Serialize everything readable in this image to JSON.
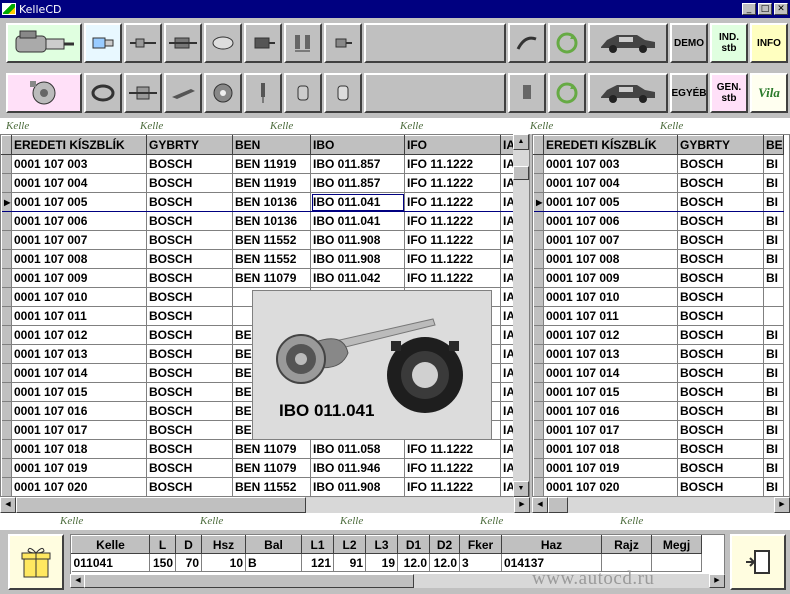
{
  "window": {
    "title": "KelleCD",
    "minimize_glyph": "_",
    "maximize_glyph": "□",
    "close_glyph": "✕"
  },
  "toolbar1": {
    "demo_label": "DEMO",
    "ind_label_1": "IND.",
    "ind_label_2": "stb",
    "info_label": "INFO"
  },
  "toolbar2": {
    "egyeb_label": "EGYÉB",
    "gen_label_1": "GEN.",
    "gen_label_2": "stb",
    "logo_text": "Vila"
  },
  "ornament_text": "Kelle",
  "grid_left": {
    "columns": [
      "EREDETI KÍSZBLÍK",
      "GYBRTY",
      "BEN",
      "IBO",
      "IFO",
      "IA"
    ],
    "rows": [
      [
        "0001 107 003",
        "BOSCH",
        "BEN 11919",
        "IBO 011.857",
        "IFO 11.1222",
        "IA"
      ],
      [
        "0001 107 004",
        "BOSCH",
        "BEN 11919",
        "IBO 011.857",
        "IFO 11.1222",
        "IA"
      ],
      [
        "0001 107 005",
        "BOSCH",
        "BEN 10136",
        "IBO 011.041",
        "IFO 11.1222",
        "IA"
      ],
      [
        "0001 107 006",
        "BOSCH",
        "BEN 10136",
        "IBO 011.041",
        "IFO 11.1222",
        "IA"
      ],
      [
        "0001 107 007",
        "BOSCH",
        "BEN 11552",
        "IBO 011.908",
        "IFO 11.1222",
        "IA"
      ],
      [
        "0001 107 008",
        "BOSCH",
        "BEN 11552",
        "IBO 011.908",
        "IFO 11.1222",
        "IA"
      ],
      [
        "0001 107 009",
        "BOSCH",
        "BEN 11079",
        "IBO 011.042",
        "IFO 11.1222",
        "IA"
      ],
      [
        "0001 107 010",
        "BOSCH",
        "",
        "",
        "",
        "IA"
      ],
      [
        "0001 107 011",
        "BOSCH",
        "",
        "",
        "",
        "IA"
      ],
      [
        "0001 107 012",
        "BOSCH",
        "BE",
        "",
        "",
        "IA"
      ],
      [
        "0001 107 013",
        "BOSCH",
        "BE",
        "",
        "",
        "IA"
      ],
      [
        "0001 107 014",
        "BOSCH",
        "BE",
        "",
        "",
        "IA"
      ],
      [
        "0001 107 015",
        "BOSCH",
        "BE",
        "",
        "",
        "IA"
      ],
      [
        "0001 107 016",
        "BOSCH",
        "BE",
        "",
        "",
        "IA"
      ],
      [
        "0001 107 017",
        "BOSCH",
        "BE",
        "",
        "",
        "IA"
      ],
      [
        "0001 107 018",
        "BOSCH",
        "BEN 11079",
        "IBO 011.058",
        "IFO 11.1222",
        "IA"
      ],
      [
        "0001 107 019",
        "BOSCH",
        "BEN 11079",
        "IBO 011.946",
        "IFO 11.1222",
        "IA"
      ],
      [
        "0001 107 020",
        "BOSCH",
        "BEN 11552",
        "IBO 011.908",
        "IFO 11.1222",
        "IA"
      ]
    ],
    "selected_row": 2
  },
  "grid_right": {
    "columns": [
      "EREDETI KÍSZBLÍK",
      "GYBRTY",
      "BE"
    ],
    "rows": [
      [
        "0001 107 003",
        "BOSCH",
        "BI"
      ],
      [
        "0001 107 004",
        "BOSCH",
        "BI"
      ],
      [
        "0001 107 005",
        "BOSCH",
        "BI"
      ],
      [
        "0001 107 006",
        "BOSCH",
        "BI"
      ],
      [
        "0001 107 007",
        "BOSCH",
        "BI"
      ],
      [
        "0001 107 008",
        "BOSCH",
        "BI"
      ],
      [
        "0001 107 009",
        "BOSCH",
        "BI"
      ],
      [
        "0001 107 010",
        "BOSCH",
        ""
      ],
      [
        "0001 107 011",
        "BOSCH",
        ""
      ],
      [
        "0001 107 012",
        "BOSCH",
        "BI"
      ],
      [
        "0001 107 013",
        "BOSCH",
        "BI"
      ],
      [
        "0001 107 014",
        "BOSCH",
        "BI"
      ],
      [
        "0001 107 015",
        "BOSCH",
        "BI"
      ],
      [
        "0001 107 016",
        "BOSCH",
        "BI"
      ],
      [
        "0001 107 017",
        "BOSCH",
        "BI"
      ],
      [
        "0001 107 018",
        "BOSCH",
        "BI"
      ],
      [
        "0001 107 019",
        "BOSCH",
        "BI"
      ],
      [
        "0001 107 020",
        "BOSCH",
        "BI"
      ]
    ],
    "selected_row": 2
  },
  "popup": {
    "caption": "IBO 011.041"
  },
  "detail": {
    "columns": [
      "Kelle",
      "L",
      "D",
      "Hsz",
      "Bal",
      "L1",
      "L2",
      "L3",
      "D1",
      "D2",
      "Fker",
      "Haz",
      "Rajz",
      "Megj"
    ],
    "row": [
      "011041",
      "150",
      "70",
      "10",
      "B",
      "121",
      "91",
      "19",
      "12.0",
      "12.0",
      "3",
      "014137",
      "",
      ""
    ]
  },
  "watermark": "www.autocd.ru",
  "colors": {
    "titlebar": "#000080",
    "face": "#c0c0c0",
    "selection": "#000080",
    "pink_button": "#ffe0f8",
    "green_button": "#e0ffe0",
    "yellow_button": "#ffffc0"
  }
}
